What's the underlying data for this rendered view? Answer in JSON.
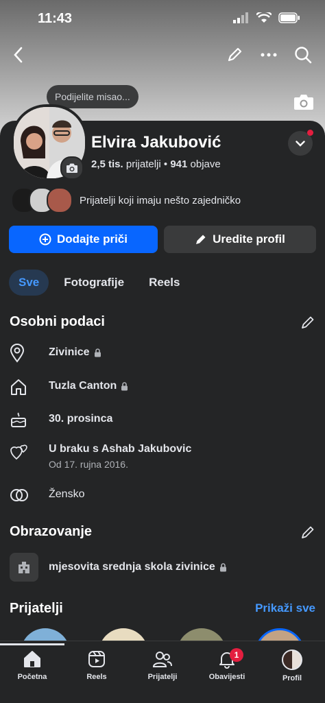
{
  "status": {
    "time": "11:43"
  },
  "profile": {
    "share_placeholder": "Podijelite misao...",
    "name": "Elvira Jakubović",
    "friends_count": "2,5 tis.",
    "friends_label": "prijatelji",
    "posts_count": "941",
    "posts_label": "objave",
    "mutual_text": "Prijatelji koji imaju nešto zajedničko"
  },
  "actions": {
    "add_story": "Dodajte priči",
    "edit_profile": "Uredite profil"
  },
  "tabs": [
    {
      "label": "Sve",
      "active": true
    },
    {
      "label": "Fotografije",
      "active": false
    },
    {
      "label": "Reels",
      "active": false
    }
  ],
  "personal": {
    "title": "Osobni podaci",
    "items": [
      {
        "icon": "location-icon",
        "text": "Zivinice",
        "locked": true
      },
      {
        "icon": "home-icon",
        "text": "Tuzla Canton",
        "locked": true
      },
      {
        "icon": "birthday-cake-icon",
        "text": "30. prosinca",
        "locked": false
      },
      {
        "icon": "relationship-icon",
        "text": "U braku s Ashab Jakubovic",
        "sub": "Od 17. rujna 2016.",
        "locked": false
      },
      {
        "icon": "gender-icon",
        "text": "Žensko",
        "locked": false
      }
    ]
  },
  "education": {
    "title": "Obrazovanje",
    "school": "mjesovita srednja skola zivinice"
  },
  "friends": {
    "title": "Prijatelji",
    "show_all": "Prikaži sve"
  },
  "nav": [
    {
      "label": "Početna",
      "icon": "home-nav-icon"
    },
    {
      "label": "Reels",
      "icon": "reels-icon"
    },
    {
      "label": "Prijatelji",
      "icon": "friends-icon"
    },
    {
      "label": "Obavijesti",
      "icon": "bell-icon",
      "badge": "1"
    },
    {
      "label": "Profil",
      "icon": "profile-avatar-icon"
    }
  ],
  "colors": {
    "accent": "#0866ff",
    "background": "#242526",
    "link": "#4599ff",
    "badge": "#e41e3f"
  }
}
